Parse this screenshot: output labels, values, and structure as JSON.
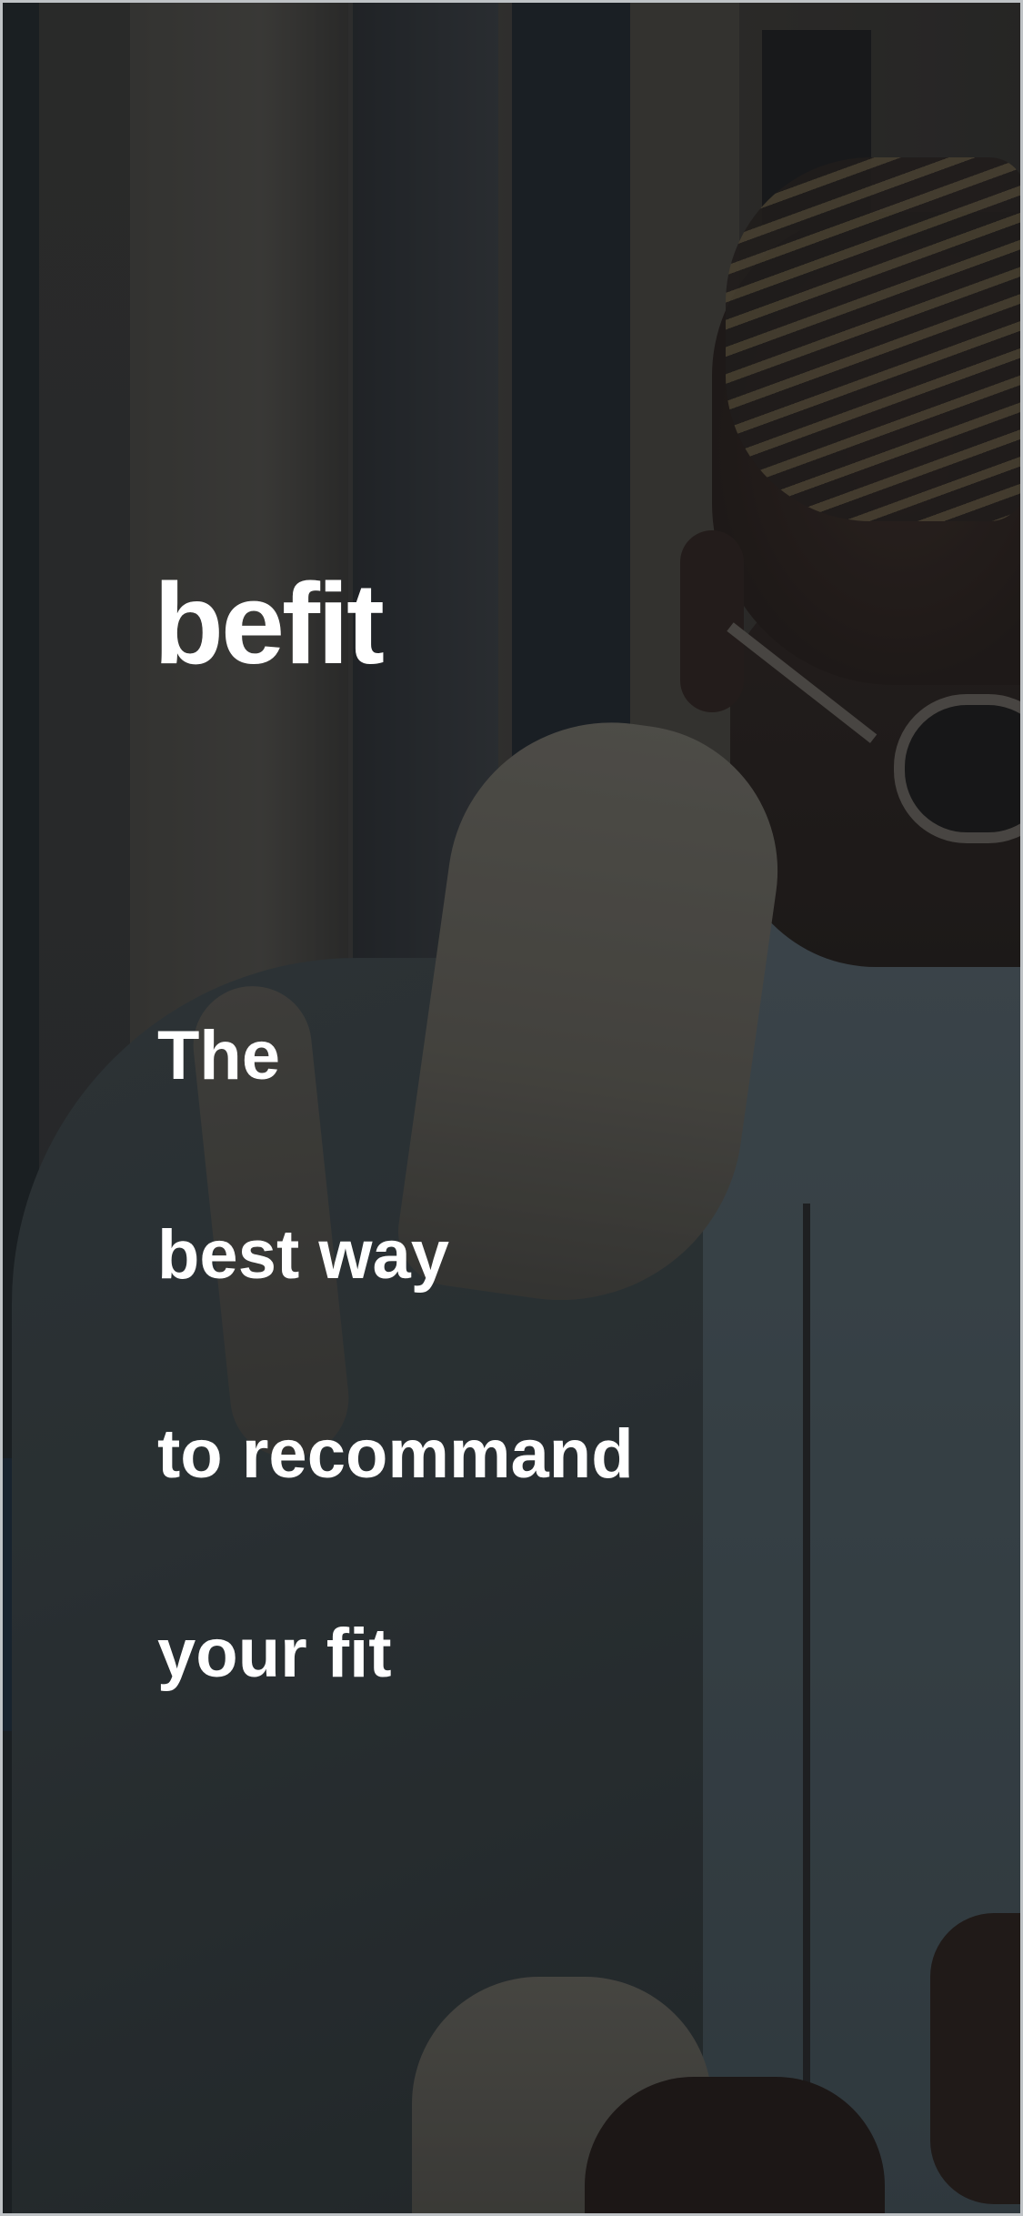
{
  "app": {
    "brand": "befit"
  },
  "tagline": {
    "lines": [
      "The",
      "best way",
      "to recommand",
      "your fit"
    ]
  },
  "background": {
    "description_icon": "fashion-model-photo",
    "overlay_color": "#121416"
  },
  "colors": {
    "text": "#ffffff",
    "frame_border": "#bfc3c6"
  }
}
